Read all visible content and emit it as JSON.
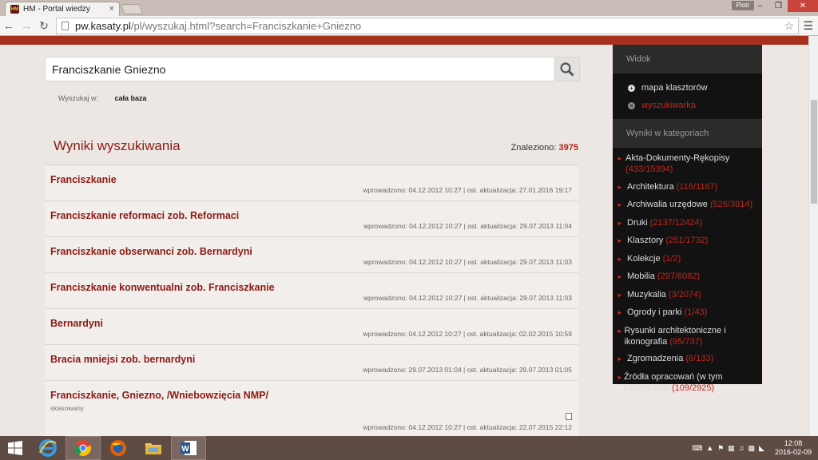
{
  "browser": {
    "tab_title": "HM - Portal wiedzy",
    "tab_close": "×",
    "user": "Piotr",
    "url_host": "pw.kasaty.pl",
    "url_path": "/pl/wyszukaj.html?search=Franciszkanie+Gniezno",
    "favicon_text": "HM"
  },
  "search": {
    "query": "Franciszkanie Gniezno",
    "scope_label": "Wyszukaj w:",
    "scope_value": "cała baza"
  },
  "results": {
    "title": "Wyniki wyszukiwania",
    "found_label": "Znaleziono:",
    "found_count": "3975",
    "items": [
      {
        "title": "Franciszkanie",
        "meta": "wprowadzono: 04.12.2012 10:27 | ost. aktualizacja: 27.01.2016 19:17"
      },
      {
        "title": "Franciszkanie reformaci zob. Reformaci",
        "meta": "wprowadzono: 04.12.2012 10:27 | ost. aktualizacja: 29.07.2013 11:04"
      },
      {
        "title": "Franciszkanie obserwanci zob. Bernardyni",
        "meta": "wprowadzono: 04.12.2012 10:27 | ost. aktualizacja: 29.07.2013 11:03"
      },
      {
        "title": "Franciszkanie konwentualni zob. Franciszkanie",
        "meta": "wprowadzono: 04.12.2012 10:27 | ost. aktualizacja: 29.07.2013 11:03"
      },
      {
        "title": "Bernardyni",
        "meta": "wprowadzono: 04.12.2012 10:27 | ost. aktualizacja: 02.02.2015 10:59"
      },
      {
        "title": "Bracia mniejsi zob. bernardyni",
        "meta": "wprowadzono: 29.07.2013 01:04 | ost. aktualizacja: 29.07.2013 01:05"
      },
      {
        "title": "Franciszkanie, Gniezno, /Wniebowzięcia NMP/",
        "sub": "skasowany",
        "meta": "wprowadzono: 04.12.2012 10:27 | ost. aktualizacja: 22.07.2015 22:12"
      }
    ]
  },
  "sidebar": {
    "view_heading": "Widok",
    "view_items": [
      {
        "label": "mapa klasztorów"
      },
      {
        "label": "wyszukiwarka"
      }
    ],
    "categories_heading": "Wyniki w kategoriach",
    "categories": [
      {
        "name": "Akta-Dokumenty-Rękopisy",
        "count": "(433/15394)"
      },
      {
        "name": "Architektura",
        "count": "(116/1167)"
      },
      {
        "name": "Archiwalia urzędowe",
        "count": "(526/3914)"
      },
      {
        "name": "Druki",
        "count": "(2137/12424)"
      },
      {
        "name": "Klasztory",
        "count": "(251/1732)"
      },
      {
        "name": "Kolekcje",
        "count": "(1/2)"
      },
      {
        "name": "Mobilia",
        "count": "(297/6082)"
      },
      {
        "name": "Muzykalia",
        "count": "(3/2074)"
      },
      {
        "name": "Ogrody i parki",
        "count": "(1/43)"
      },
      {
        "name": "Rysunki architektoniczne i ikonografia",
        "count": "(95/737)"
      },
      {
        "name": "Zgromadzenia",
        "count": "(6/133)"
      },
      {
        "name": "Źródła opracowań (w tym bibliografia)",
        "count": "(109/2925)"
      }
    ]
  },
  "taskbar": {
    "time": "12:08",
    "date": "2016-02-09"
  }
}
